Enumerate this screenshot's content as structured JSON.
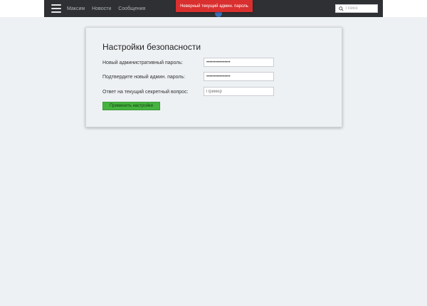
{
  "nav": {
    "links": [
      "Максим",
      "Новости",
      "Сообщения"
    ],
    "search_placeholder": "Поиск"
  },
  "toast": {
    "message": "Неверный текущий админ. пароль"
  },
  "form": {
    "title": "Настройки безопасности",
    "new_password_label": "Новый административный пароль:",
    "new_password_value": "••••••••••••••••",
    "confirm_password_label": "Подтвердите новый админ. пароль:",
    "confirm_password_value": "••••••••••••••••",
    "secret_answer_label": "Ответ на текущий секретный вопрос:",
    "secret_answer_placeholder": "Пример",
    "apply_button": "Применить настройки"
  },
  "colors": {
    "navbar": "#2e3033",
    "toast": "#d92f2f",
    "button": "#45b33f"
  },
  "icons": [
    "menu-icon",
    "search-icon"
  ]
}
